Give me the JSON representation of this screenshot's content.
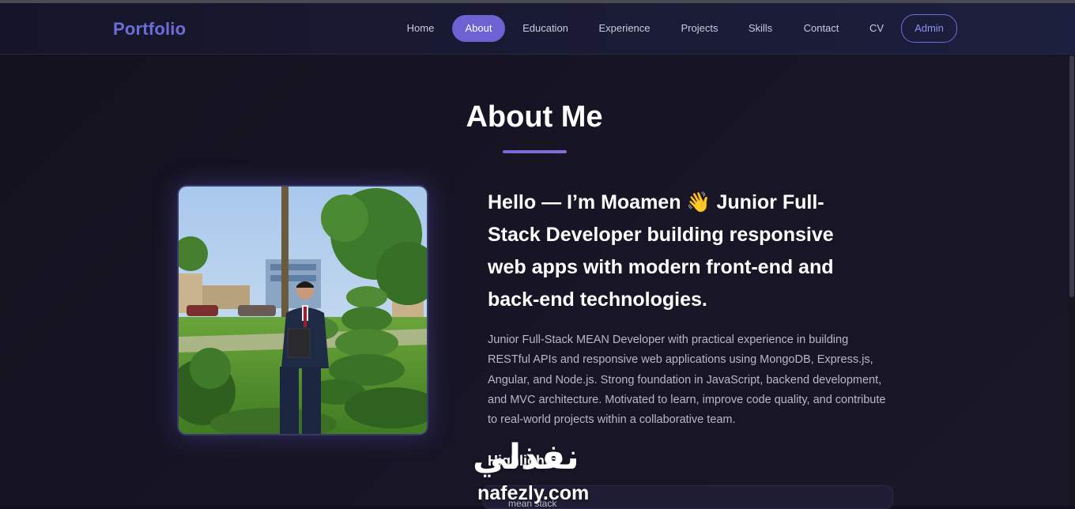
{
  "brand": "Portfolio",
  "nav": {
    "home": "Home",
    "about": "About",
    "education": "Education",
    "experience": "Experience",
    "projects": "Projects",
    "skills": "Skills",
    "contact": "Contact",
    "cv": "CV",
    "admin": "Admin"
  },
  "active_nav": "About",
  "about": {
    "title": "About Me",
    "headline": "Hello — I’m Moamen 👋 Junior Full-Stack Developer building responsive web apps with modern front-end and back-end technologies.",
    "bio": "Junior Full-Stack MEAN Developer with practical experience in building RESTful APIs and responsive web applications using MongoDB, Express.js, Angular, and Node.js. Strong foundation in JavaScript, backend development, and MVC architecture. Motivated to learn, improve code quality, and contribute to real-world projects within a collaborative team.",
    "highlights_title": "Highlights",
    "highlight_item": "mean stack"
  },
  "watermark": {
    "arabic": "نفذلي",
    "latin": "nafezly.com"
  },
  "colors": {
    "accent": "#6d62d3",
    "brand": "#6f6cd6",
    "background": "#14121e",
    "text_muted": "#b6b8c9"
  }
}
